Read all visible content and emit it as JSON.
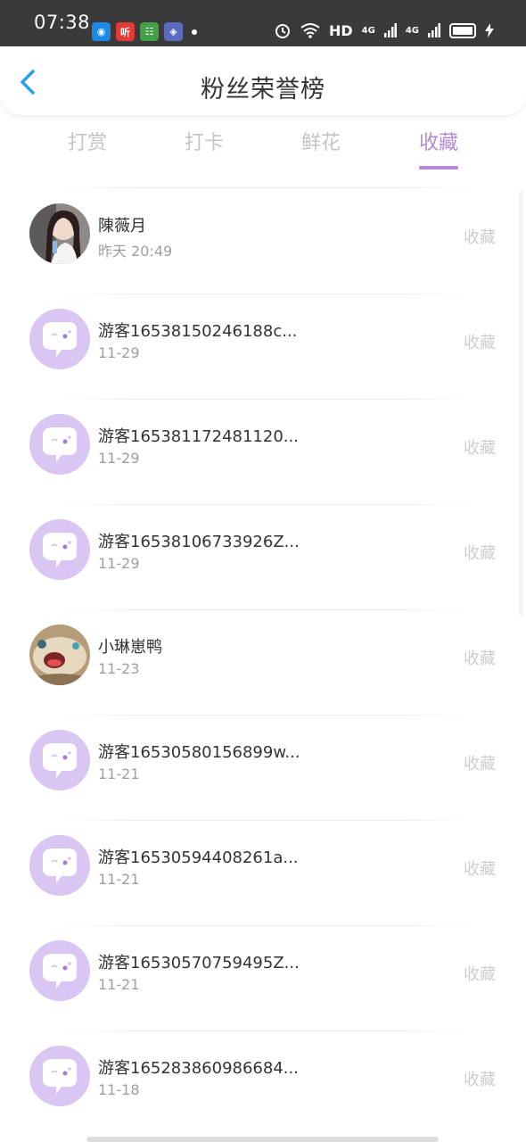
{
  "status_bar": {
    "time": "07:38",
    "hd_label": "HD",
    "net_label_1": "4G",
    "net_label_2": "4G",
    "app_icons": [
      {
        "name": "browser-app-icon",
        "color": "#1e88e5",
        "glyph": "◉"
      },
      {
        "name": "listen-app-icon",
        "color": "#e53935",
        "glyph": "听"
      },
      {
        "name": "shop-app-icon",
        "color": "#43a047",
        "glyph": "☷"
      },
      {
        "name": "gallery-app-icon",
        "color": "#5c6bc0",
        "glyph": "◈"
      }
    ]
  },
  "header": {
    "title": "粉丝荣誉榜"
  },
  "tabs": [
    {
      "label": "打赏",
      "active": false
    },
    {
      "label": "打卡",
      "active": false
    },
    {
      "label": "鲜花",
      "active": false
    },
    {
      "label": "收藏",
      "active": true
    }
  ],
  "colors": {
    "accent": "#b48ad8",
    "avatar_default": "#d9c6f2"
  },
  "fans": [
    {
      "name": "陳薇月",
      "date": "昨天 20:49",
      "action": "收藏",
      "avatar": "photo-girl"
    },
    {
      "name": "游客16538150246188c...",
      "date": "11-29",
      "action": "收藏",
      "avatar": "default"
    },
    {
      "name": "游客165381172481120...",
      "date": "11-29",
      "action": "收藏",
      "avatar": "default"
    },
    {
      "name": "游客16538106733926Z...",
      "date": "11-29",
      "action": "收藏",
      "avatar": "default"
    },
    {
      "name": "小琳崽鸭",
      "date": "11-23",
      "action": "收藏",
      "avatar": "photo-duck"
    },
    {
      "name": "游客16530580156899w...",
      "date": "11-21",
      "action": "收藏",
      "avatar": "default"
    },
    {
      "name": "游客16530594408261a...",
      "date": "11-21",
      "action": "收藏",
      "avatar": "default"
    },
    {
      "name": "游客16530570759495Z...",
      "date": "11-21",
      "action": "收藏",
      "avatar": "default"
    },
    {
      "name": "游客165283860986684...",
      "date": "11-18",
      "action": "收藏",
      "avatar": "default"
    }
  ]
}
